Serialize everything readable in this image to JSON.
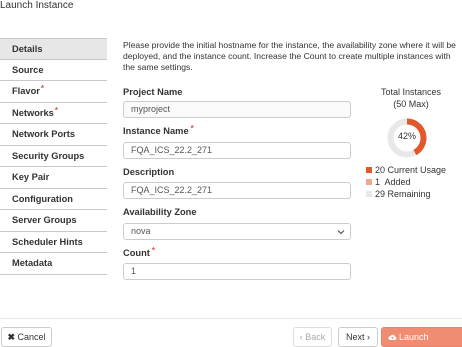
{
  "dialog": {
    "title": "Launch Instance"
  },
  "sidebar": {
    "items": [
      {
        "label": "Details"
      },
      {
        "label": "Source"
      },
      {
        "label": "Flavor",
        "required": "*"
      },
      {
        "label": "Networks",
        "required": "*"
      },
      {
        "label": "Network Ports"
      },
      {
        "label": "Security Groups"
      },
      {
        "label": "Key Pair"
      },
      {
        "label": "Configuration"
      },
      {
        "label": "Server Groups"
      },
      {
        "label": "Scheduler Hints"
      },
      {
        "label": "Metadata"
      }
    ]
  },
  "main": {
    "description": "Please provide the initial hostname for the instance, the availability zone where it will be deployed, and the instance count. Increase the Count to create multiple instances with the same settings.",
    "project_name": {
      "label": "Project Name",
      "value": "myproject"
    },
    "instance_name": {
      "label": "Instance Name",
      "required": "*",
      "value": "FQA_ICS_22.2_271"
    },
    "description_field": {
      "label": "Description",
      "value": "FQA_ICS_22.2_271"
    },
    "availability_zone": {
      "label": "Availability Zone",
      "value": "nova"
    },
    "count": {
      "label": "Count",
      "required": "*",
      "value": "1"
    }
  },
  "stats": {
    "title": "Total Instances",
    "max": "(50 Max)",
    "percent_label": "42%",
    "percent": 0.42,
    "legend": [
      {
        "count": "20",
        "label": "Current Usage",
        "color": "#e0582c"
      },
      {
        "count": "1",
        "label": "Added",
        "color": "#f6a58e"
      },
      {
        "count": "29",
        "label": "Remaining",
        "color": "#e8e8e8"
      }
    ],
    "colors": {
      "used": "#e0582c",
      "added": "#f6a58e",
      "remaining": "#e8e8e8"
    }
  },
  "footer": {
    "cancel": "Cancel",
    "back": "‹ Back",
    "next": "Next ›",
    "launch": "Launch Instance",
    "accent": "#f08c72"
  }
}
